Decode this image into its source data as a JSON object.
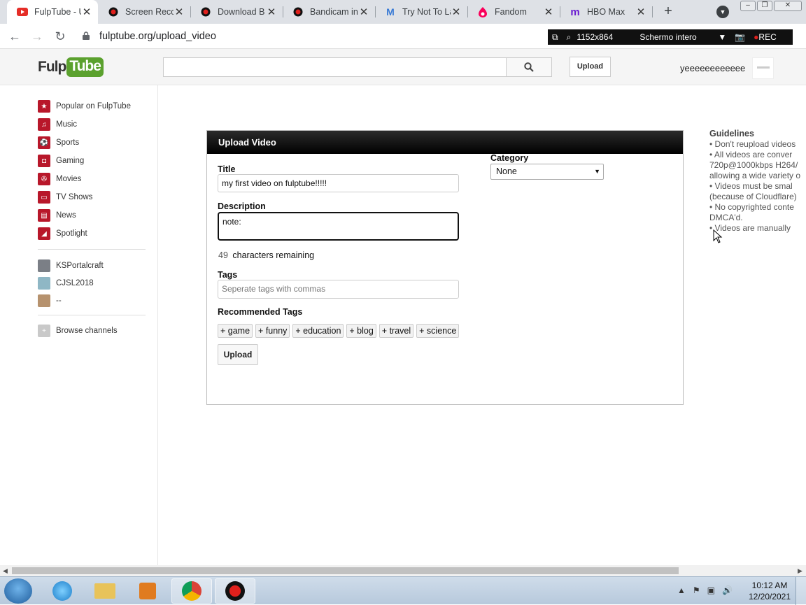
{
  "browser": {
    "tabs": [
      {
        "title": "FulpTube - U",
        "favicon": "youtube-icon",
        "active": true
      },
      {
        "title": "Screen Reco",
        "favicon": "record-icon",
        "active": false
      },
      {
        "title": "Download B",
        "favicon": "record-icon",
        "active": false
      },
      {
        "title": "Bandicam in",
        "favicon": "record-icon",
        "active": false
      },
      {
        "title": "Try Not To La",
        "favicon": "m-icon",
        "active": false
      },
      {
        "title": "Fandom",
        "favicon": "fandom-icon",
        "active": false
      },
      {
        "title": "HBO Max",
        "favicon": "hbo-max-icon",
        "active": false
      }
    ],
    "close_glyph": "✕",
    "new_tab_glyph": "+",
    "url": "fulptube.org/upload_video"
  },
  "bandicam": {
    "resolution": "1152x864",
    "mode": "Schermo intero",
    "rec": "REC"
  },
  "site": {
    "logo_left": "Fulp",
    "logo_right": "Tube",
    "search_value": "",
    "upload_label": "Upload",
    "username": "yeeeeeeeeeeee"
  },
  "sidebar": {
    "nav": [
      {
        "label": "Popular on FulpTube",
        "icon": "star-icon"
      },
      {
        "label": "Music",
        "icon": "headphones-icon"
      },
      {
        "label": "Sports",
        "icon": "sports-icon"
      },
      {
        "label": "Gaming",
        "icon": "gamepad-icon"
      },
      {
        "label": "Movies",
        "icon": "film-icon"
      },
      {
        "label": "TV Shows",
        "icon": "tv-icon"
      },
      {
        "label": "News",
        "icon": "news-icon"
      },
      {
        "label": "Spotlight",
        "icon": "spotlight-icon"
      }
    ],
    "channels": [
      {
        "label": "KSPortalcraft",
        "icon": "channel-avatar-icon"
      },
      {
        "label": "CJSL2018",
        "icon": "channel-avatar-icon"
      },
      {
        "label": "--",
        "icon": "channel-avatar-icon"
      }
    ],
    "browse": {
      "label": "Browse channels",
      "icon": "plus-icon"
    }
  },
  "upload_form": {
    "heading": "Upload Video",
    "title_label": "Title",
    "title_value": "my first video on fulptube!!!!!",
    "description_label": "Description",
    "description_value": "note:",
    "remaining_count": "49",
    "remaining_text": "characters remaining",
    "tags_label": "Tags",
    "tags_placeholder": "Seperate tags with commas",
    "recommended_label": "Recommended Tags",
    "recommended_tags": [
      "+ game",
      "+ funny",
      "+ education",
      "+ blog",
      "+ travel",
      "+ science"
    ],
    "upload_button": "Upload",
    "category_label": "Category",
    "category_value": "None"
  },
  "guidelines": {
    "title": "Guidelines",
    "lines": [
      "•   Don't reupload videos",
      "•   All videos are conver",
      "720p@1000kbps H264/",
      "allowing a wide variety o",
      "•   Videos must be smal",
      "(because of Cloudflare)",
      "•   No copyrighted conte",
      "DMCA'd.",
      "•   Videos are manually"
    ]
  },
  "taskbar": {
    "time": "10:12 AM",
    "date": "12/20/2021"
  }
}
